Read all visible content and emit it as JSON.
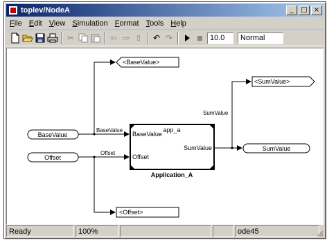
{
  "window": {
    "title": "toplev/NodeA"
  },
  "title_buttons": [
    "_",
    "□",
    "×"
  ],
  "menu": [
    {
      "label": "File",
      "u": "F",
      "rest": "ile"
    },
    {
      "label": "Edit",
      "u": "E",
      "rest": "dit"
    },
    {
      "label": "View",
      "u": "V",
      "rest": "iew"
    },
    {
      "label": "Simulation",
      "u": "S",
      "rest": "imulation"
    },
    {
      "label": "Format",
      "u": "F",
      "rest": "ormat"
    },
    {
      "label": "Tools",
      "u": "T",
      "rest": "ools"
    },
    {
      "label": "Help",
      "u": "H",
      "rest": "elp"
    }
  ],
  "toolbar": {
    "stop_time": "10.0",
    "sim_mode": "Normal"
  },
  "diagram": {
    "inports": [
      "BaseValue",
      "Offset"
    ],
    "outport": "SumValue",
    "goto_tags": [
      "<BaseValue>",
      "<Offset>",
      "<SumValue>"
    ],
    "block": {
      "instance": "app_a",
      "name": "Application_A",
      "in_ports": [
        "BaseValue",
        "Offset"
      ],
      "out_port": "SumValue"
    },
    "signals": {
      "base": "BaseValue",
      "offset": "Offset",
      "sum": "SumValue"
    }
  },
  "status": {
    "state": "Ready",
    "zoom": "100%",
    "solver": "ode45"
  }
}
